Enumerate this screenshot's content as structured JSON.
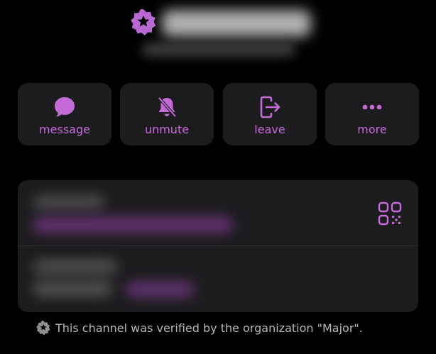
{
  "header": {
    "badge_icon": "verified-star-badge-icon",
    "title_hidden": "",
    "subtitle_hidden": ""
  },
  "actions": [
    {
      "label": "message",
      "icon": "chat-bubble-icon"
    },
    {
      "label": "unmute",
      "icon": "bell-slash-icon"
    },
    {
      "label": "leave",
      "icon": "exit-icon"
    },
    {
      "label": "more",
      "icon": "ellipsis-icon"
    }
  ],
  "info": {
    "qr_icon": "qr-code-icon"
  },
  "footer": {
    "note": "This channel was verified by the organization \"Major\"."
  },
  "colors": {
    "accent": "#c46bd8",
    "card_bg": "#1c1c1e",
    "page_bg": "#000000",
    "muted_text": "#b9b9bd"
  }
}
